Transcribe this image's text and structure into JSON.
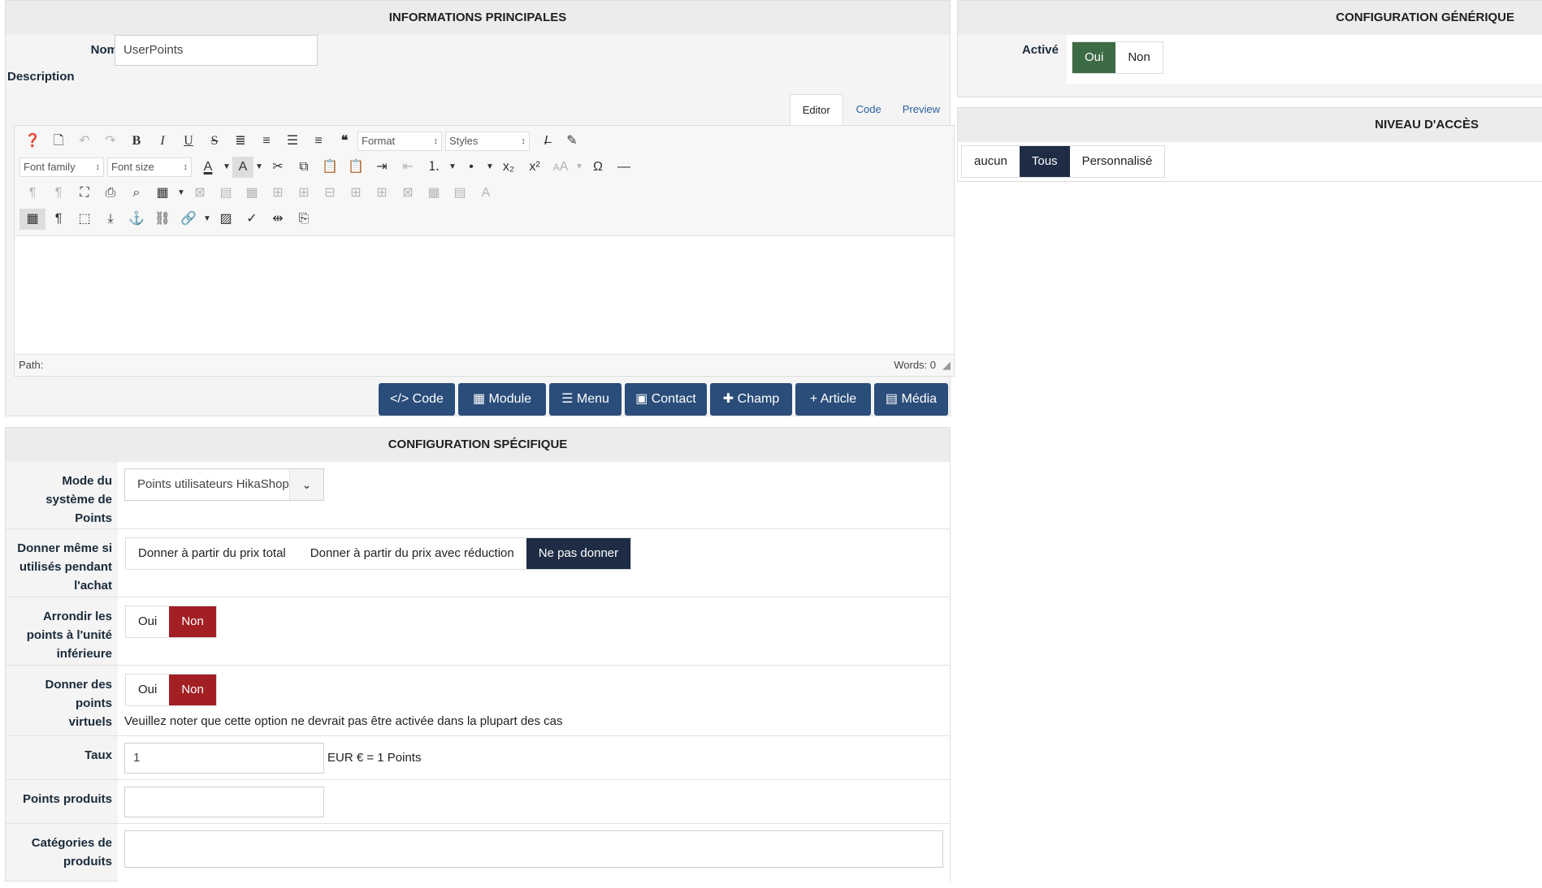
{
  "main_panel": {
    "title": "INFORMATIONS PRINCIPALES",
    "nom_label": "Nom",
    "nom_value": "UserPoints",
    "description_label": "Description",
    "editor_tabs": [
      "Editor",
      "Code",
      "Preview"
    ],
    "toolbar": {
      "format": "Format",
      "styles": "Styles",
      "font_family": "Font family",
      "font_size": "Font size"
    },
    "status": {
      "path": "Path:",
      "words": "Words: 0"
    },
    "insert_buttons": [
      {
        "icon": "code-icon",
        "glyph": "</>",
        "label": "Code"
      },
      {
        "icon": "module-icon",
        "glyph": "▦",
        "label": "Module"
      },
      {
        "icon": "menu-icon",
        "glyph": "☰",
        "label": "Menu"
      },
      {
        "icon": "contact-icon",
        "glyph": "▣",
        "label": "Contact"
      },
      {
        "icon": "puzzle-icon",
        "glyph": "✚",
        "label": "Champ"
      },
      {
        "icon": "plus-icon",
        "glyph": "+",
        "label": "Article"
      },
      {
        "icon": "image-icon",
        "glyph": "▤",
        "label": "Média"
      }
    ]
  },
  "generic_config": {
    "title": "CONFIGURATION GÉNÉRIQUE",
    "active_label": "Activé",
    "options": [
      "Oui",
      "Non"
    ],
    "selected": "Oui"
  },
  "access_level": {
    "title": "NIVEAU D'ACCÈS",
    "options": [
      "aucun",
      "Tous",
      "Personnalisé"
    ],
    "selected": "Tous"
  },
  "specific_config": {
    "title": "CONFIGURATION SPÉCIFIQUE",
    "mode_label": "Mode du système de Points",
    "mode_value": "Points utilisateurs HikaShop",
    "give_label": "Donner même si utilisés pendant l'achat",
    "give_options": [
      "Donner à partir du prix total",
      "Donner à partir du prix avec réduction",
      "Ne pas donner"
    ],
    "give_selected": "Ne pas donner",
    "round_label": "Arrondir les points à l'unité inférieure",
    "round_options": [
      "Oui",
      "Non"
    ],
    "round_selected": "Non",
    "virtual_label": "Donner des points virtuels",
    "virtual_options": [
      "Oui",
      "Non"
    ],
    "virtual_selected": "Non",
    "virtual_note": "Veuillez noter que cette option ne devrait pas être activée dans la plupart des cas",
    "rate_label": "Taux",
    "rate_value": "1",
    "rate_suffix": "EUR € = 1 Points",
    "product_points_label": "Points produits",
    "product_points_value": "",
    "categories_label": "Catégories de produits",
    "categories_value": ""
  },
  "colors": {
    "green": "#3d6b46",
    "red": "#a21f24",
    "navy": "#1e2d45",
    "button_blue": "#2a4d7a"
  }
}
